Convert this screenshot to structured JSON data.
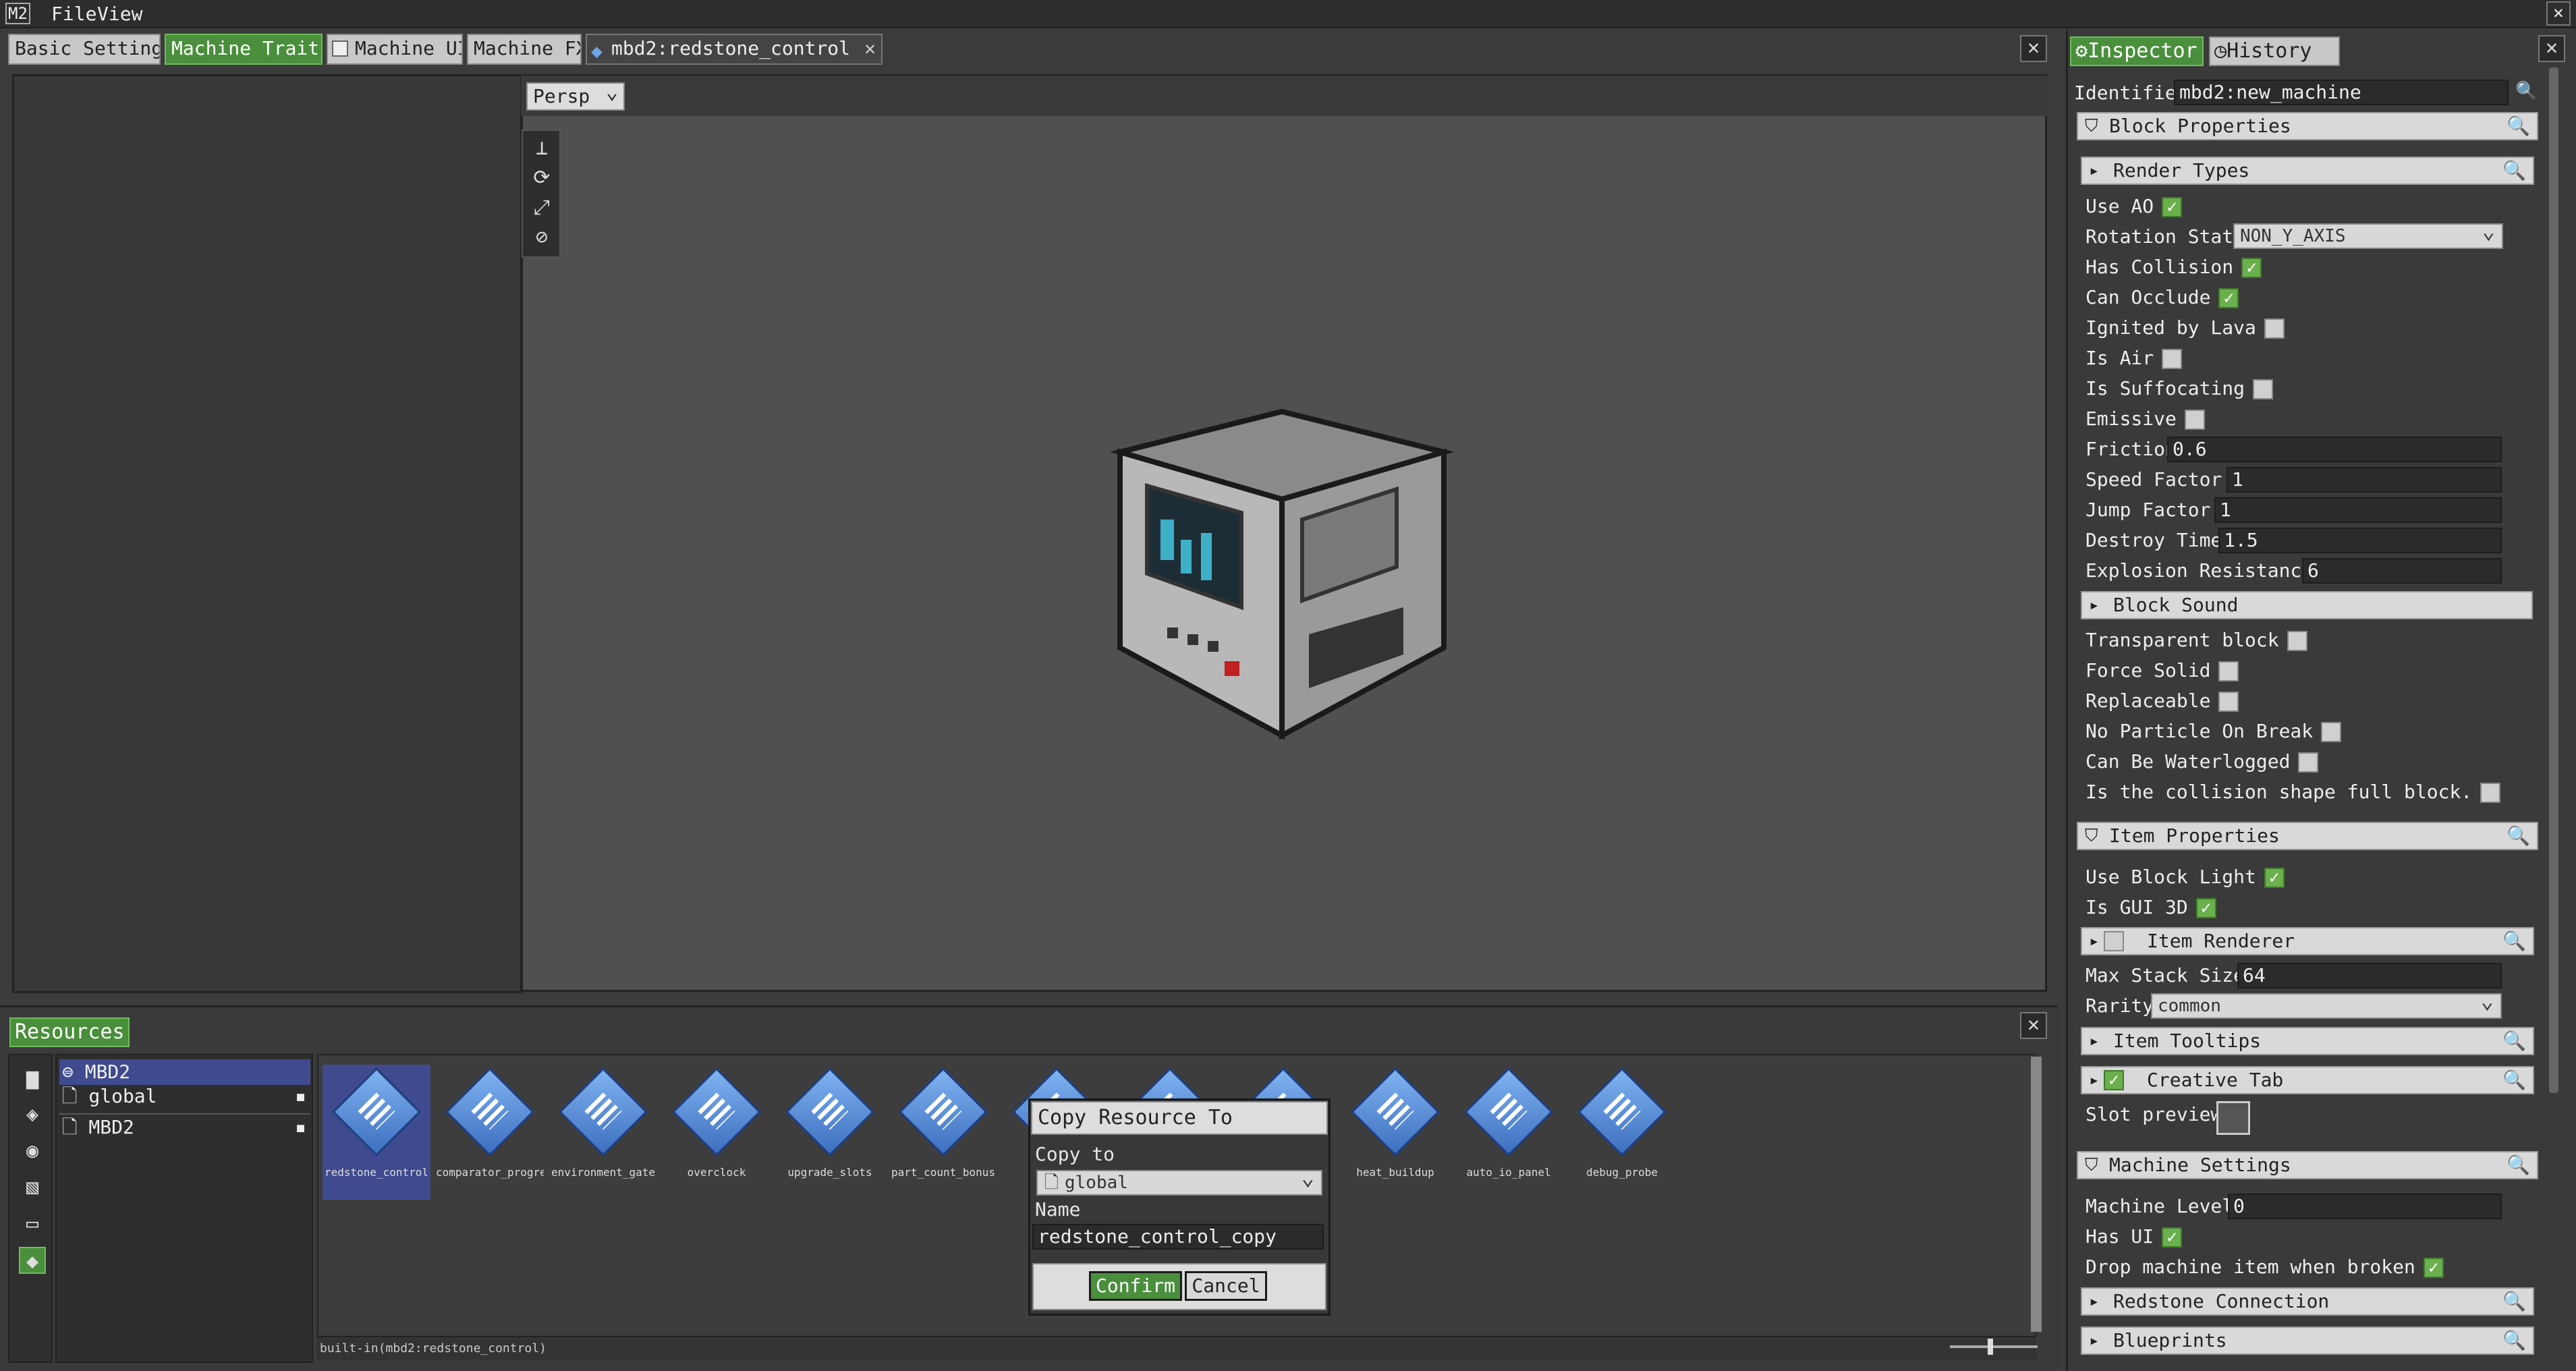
{
  "menubar": {
    "logo": "M2",
    "file": "File",
    "view": "View"
  },
  "tabs": [
    {
      "label": "Basic Settings"
    },
    {
      "label": "Machine Traits"
    },
    {
      "label": "Machine UI"
    },
    {
      "label": "Machine FX"
    },
    {
      "label": "mbd2:redstone_control"
    }
  ],
  "viewport": {
    "camera_mode": "Persp"
  },
  "inspector": {
    "tab_inspector": "Inspector",
    "tab_history": "History",
    "identifier_label": "Identifier",
    "identifier_value": "mbd2:new_machine",
    "block_properties": "Block Properties",
    "render_types": "Render Types",
    "use_ao": "Use AO",
    "rotation_state_label": "Rotation State",
    "rotation_state_value": "NON_Y_AXIS",
    "has_collision": "Has Collision",
    "can_occlude": "Can Occlude",
    "ignited_by_lava": "Ignited by Lava",
    "is_air": "Is Air",
    "is_suffocating": "Is Suffocating",
    "emissive": "Emissive",
    "friction_label": "Friction",
    "friction_value": "0.6",
    "speed_factor_label": "Speed Factor",
    "speed_factor_value": "1",
    "jump_factor_label": "Jump Factor",
    "jump_factor_value": "1",
    "destroy_time_label": "Destroy Time",
    "destroy_time_value": "1.5",
    "explosion_resistance_label": "Explosion Resistance",
    "explosion_resistance_value": "6",
    "block_sound": "Block Sound",
    "transparent_block": "Transparent block",
    "force_solid": "Force Solid",
    "replaceable": "Replaceable",
    "no_particle_on_break": "No Particle On Break",
    "can_be_waterlogged": "Can Be Waterlogged",
    "collision_full_block": "Is the collision shape full block.",
    "item_properties": "Item Properties",
    "use_block_light": "Use Block Light",
    "is_gui_3d": "Is GUI 3D",
    "item_renderer": "Item Renderer",
    "max_stack_size_label": "Max Stack Size",
    "max_stack_size_value": "64",
    "rarity_label": "Rarity",
    "rarity_value": "common",
    "item_tooltips": "Item Tooltips",
    "creative_tab": "Creative Tab",
    "slot_preview": "Slot preview",
    "machine_settings": "Machine Settings",
    "machine_level_label": "Machine Level",
    "machine_level_value": "0",
    "has_ui": "Has UI",
    "drop_machine_item": "Drop machine item when broken",
    "redstone_connection": "Redstone Connection",
    "blueprints": "Blueprints"
  },
  "resources": {
    "tab_label": "Resources",
    "tree": [
      {
        "label": "MBD2"
      },
      {
        "label": "global"
      },
      {
        "label": "MBD2"
      }
    ],
    "items": [
      {
        "label": "redstone_control"
      },
      {
        "label": "comparator_progre"
      },
      {
        "label": "environment_gate"
      },
      {
        "label": "overclock"
      },
      {
        "label": "upgrade_slots"
      },
      {
        "label": "part_count_bonus"
      },
      {
        "label": "heat_buildup"
      },
      {
        "label": "auto_io_panel"
      },
      {
        "label": "debug_probe"
      }
    ],
    "status": "built-in(mbd2:redstone_control)"
  },
  "dialog": {
    "title": "Copy Resource To",
    "copy_to_label": "Copy to",
    "copy_to_value": "global",
    "name_label": "Name",
    "name_value": "redstone_control_copy",
    "confirm": "Confirm",
    "cancel": "Cancel"
  }
}
